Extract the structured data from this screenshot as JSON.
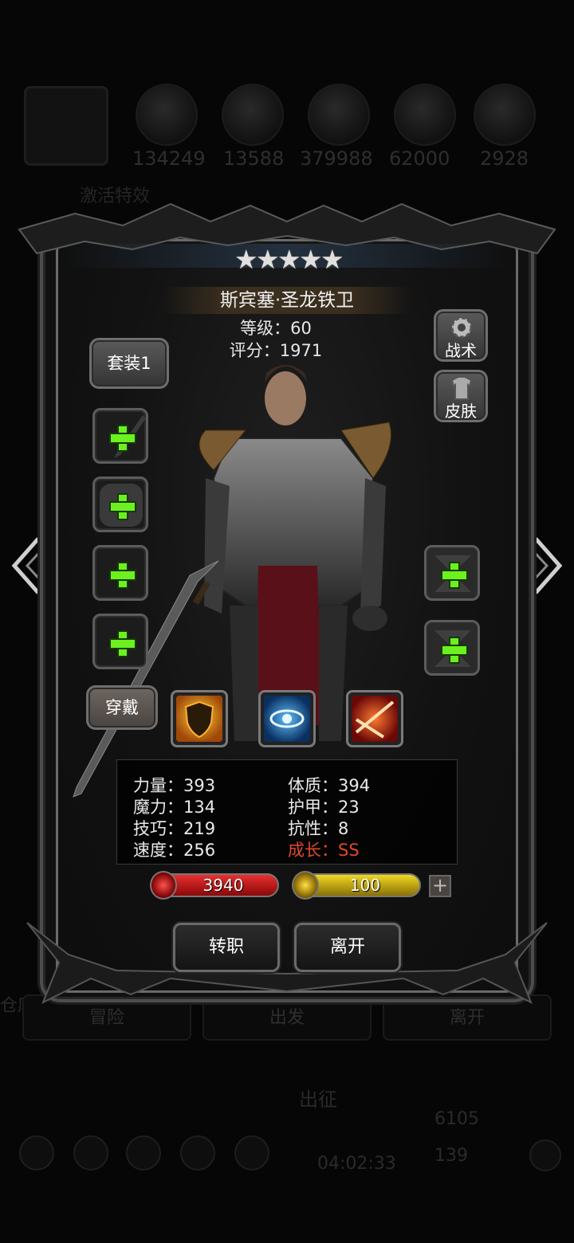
{
  "background": {
    "resources": [
      "134249",
      "13588",
      "379988",
      "62000",
      "2928"
    ],
    "subtitle": "激活特效",
    "bottom_tabs": [
      "冒险",
      "出发",
      "离开"
    ],
    "left_edge_label": "仓库",
    "expedition_label": "出征",
    "timer": "04:02:33",
    "currency_1": "6105",
    "currency_2": "139"
  },
  "hero": {
    "stars": 5,
    "star_glyph": "★",
    "name": "斯宾塞·圣龙铁卫",
    "level_text": "等级：60",
    "score_text": "评分：1971"
  },
  "buttons": {
    "outfit_set": "套装1",
    "tactics": "战术",
    "skin": "皮肤",
    "wear": "穿戴",
    "change_job": "转职",
    "leave": "离开"
  },
  "equipment_slots": [
    "weapon-slot",
    "armor-slot",
    "accessory-slot",
    "boots-slot"
  ],
  "right_slots": [
    "ring-slot-1",
    "ring-slot-2"
  ],
  "skills": [
    {
      "name": "shield-skill-icon",
      "color": "#e8a020"
    },
    {
      "name": "eye-skill-icon",
      "color": "#2a8ae0"
    },
    {
      "name": "slash-skill-icon",
      "color": "#d83018"
    }
  ],
  "stats": {
    "strength": "力量：393",
    "magic": "魔力：134",
    "skill": "技巧：219",
    "speed": "速度：256",
    "constitution": "体质：394",
    "armor": "护甲：23",
    "resistance": "抗性：8",
    "growth": "成长：SS"
  },
  "bars": {
    "hp": "3940",
    "energy": "100",
    "add": "+"
  },
  "colors": {
    "plus_green": "#6cf020",
    "hp_red": "#c81818",
    "energy_yellow": "#e0c010",
    "growth_red": "#e0482a"
  }
}
